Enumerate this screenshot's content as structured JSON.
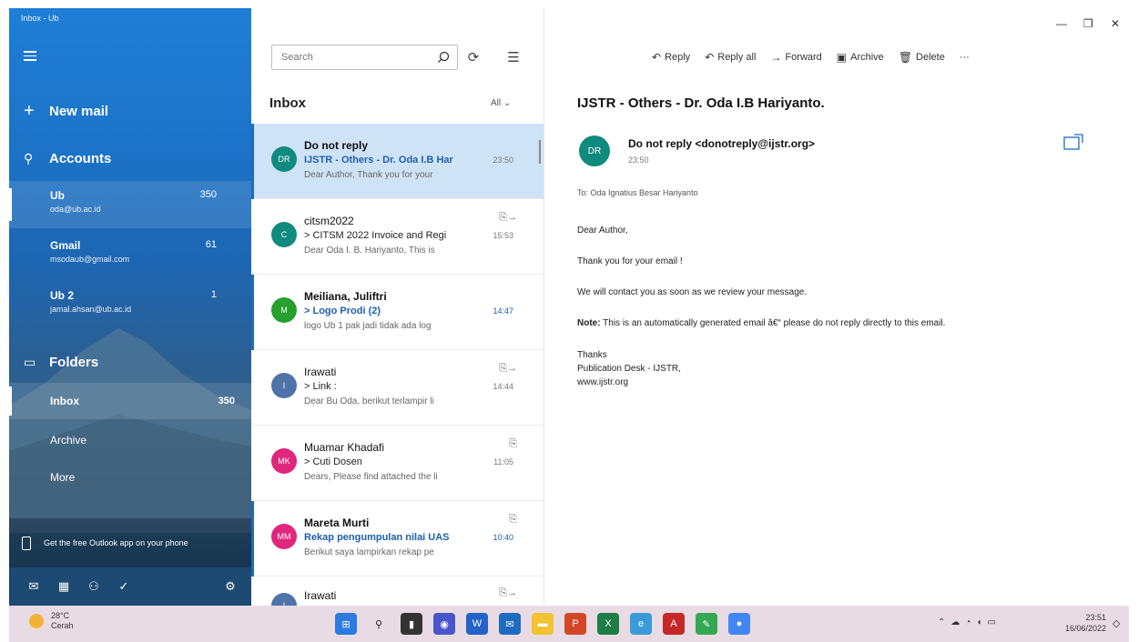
{
  "window": {
    "title": "Inbox - Ub"
  },
  "sidebar": {
    "new_mail": "New mail",
    "accounts_label": "Accounts",
    "accounts": [
      {
        "name": "Ub",
        "email": "oda@ub.ac.id",
        "count": "350"
      },
      {
        "name": "Gmail",
        "email": "msodaub@gmail.com",
        "count": "61"
      },
      {
        "name": "Ub 2",
        "email": "jamal.ahsan@ub.ac.id",
        "count": "1"
      }
    ],
    "folders_label": "Folders",
    "folders": [
      {
        "name": "Inbox",
        "count": "350"
      },
      {
        "name": "Archive",
        "count": ""
      },
      {
        "name": "More",
        "count": ""
      }
    ],
    "promo": "Get the free Outlook app on your phone"
  },
  "list": {
    "search_placeholder": "Search",
    "header": "Inbox",
    "filter": "All",
    "messages": [
      {
        "initials": "DR",
        "color": "#0f8a7e",
        "sender": "Do not reply",
        "subject": "IJSTR - Others - Dr. Oda I.B Har",
        "preview": "Dear Author, Thank you for your",
        "time": "23:50",
        "flags": "",
        "unread": true,
        "selected": true
      },
      {
        "initials": "C",
        "color": "#0f8a7e",
        "sender": "citsm2022",
        "subject": "> CITSM 2022 Invoice and Regi",
        "preview": "Dear Oda I. B. Hariyanto, This is",
        "time": "15:53",
        "flags": "⎘→",
        "unread": false,
        "selected": false
      },
      {
        "initials": "M",
        "color": "#27a02e",
        "sender": "Meiliana, Juliftri",
        "subject": "> Logo Prodi (2)",
        "preview": "logo Ub 1 pak jadi tidak ada log",
        "time": "14:47",
        "flags": "",
        "unread": true,
        "selected": false
      },
      {
        "initials": "I",
        "color": "#4e73a8",
        "sender": "Irawati",
        "subject": "> Link :",
        "preview": "Dear Bu Oda, berikut terlampir li",
        "time": "14:44",
        "flags": "⎘→",
        "unread": false,
        "selected": false
      },
      {
        "initials": "MK",
        "color": "#e0267d",
        "sender": "Muamar Khadafi",
        "subject": "> Cuti Dosen",
        "preview": "Dears, Please find attached the li",
        "time": "11:05",
        "flags": "⎘",
        "unread": false,
        "selected": false
      },
      {
        "initials": "MM",
        "color": "#e0267d",
        "sender": "Mareta Murti",
        "subject": "Rekap pengumpulan nilai UAS",
        "preview": "Berikut saya lampirkan rekap pe",
        "time": "10:40",
        "flags": "⎘",
        "unread": true,
        "selected": false
      },
      {
        "initials": "I",
        "color": "#4e73a8",
        "sender": "Irawati",
        "subject": "",
        "preview": "",
        "time": "",
        "flags": "⎘→",
        "unread": false,
        "selected": false
      }
    ]
  },
  "reader": {
    "toolbar": {
      "reply": "Reply",
      "reply_all": "Reply all",
      "forward": "Forward",
      "archive": "Archive",
      "delete": "Delete",
      "more": "···"
    },
    "subject": "IJSTR - Others - Dr. Oda I.B Hariyanto.",
    "from_initials": "DR",
    "from": "Do not reply <donotreply@ijstr.org>",
    "time": "23:50",
    "to": "To: Oda Ignatius Besar Hariyanto",
    "body": {
      "greeting": "Dear Author,",
      "line1": "Thank you for your email !",
      "line2": "We will contact you as soon as we review your message.",
      "note_label": "Note:",
      "note": " This is an automatically generated email â€“ please do not reply directly to this email.",
      "sig1": "Thanks",
      "sig2": "Publication Desk - IJSTR,",
      "sig3": "www.ijstr.org"
    }
  },
  "taskbar": {
    "weather_temp": "28°C",
    "weather_desc": "Cerah",
    "time": "23:51",
    "date": "16/06/2022"
  }
}
